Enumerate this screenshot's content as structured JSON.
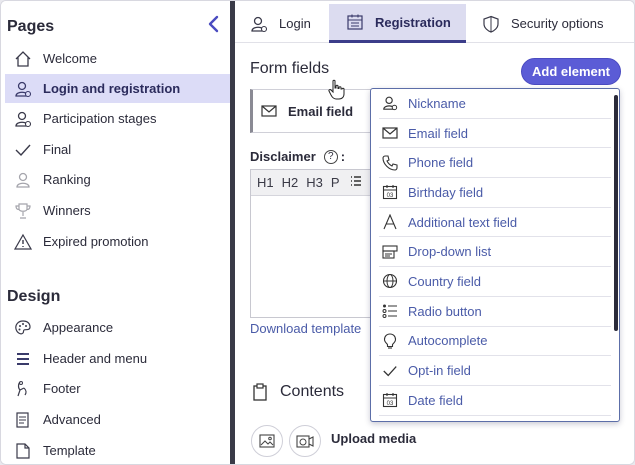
{
  "sidebar": {
    "pages_title": "Pages",
    "design_title": "Design",
    "pages": [
      {
        "label": "Welcome",
        "icon": "home-icon"
      },
      {
        "label": "Login and registration",
        "icon": "user-icon",
        "active": true
      },
      {
        "label": "Participation stages",
        "icon": "user-icon"
      },
      {
        "label": "Final",
        "icon": "check-icon"
      },
      {
        "label": "Ranking",
        "icon": "ranking-icon"
      },
      {
        "label": "Winners",
        "icon": "trophy-icon"
      },
      {
        "label": "Expired promotion",
        "icon": "warning-icon"
      }
    ],
    "design": [
      {
        "label": "Appearance",
        "icon": "palette-icon"
      },
      {
        "label": "Header and menu",
        "icon": "menu-icon"
      },
      {
        "label": "Footer",
        "icon": "footer-icon"
      },
      {
        "label": "Advanced",
        "icon": "advanced-icon"
      },
      {
        "label": "Template",
        "icon": "template-icon"
      }
    ]
  },
  "tabs": [
    {
      "label": "Login",
      "icon": "user-icon"
    },
    {
      "label": "Registration",
      "icon": "calendar-icon",
      "active": true
    },
    {
      "label": "Security options",
      "icon": "shield-icon"
    }
  ],
  "main": {
    "form_title": "Form fields",
    "add_button": "Add element",
    "email_card": "Email field",
    "disclaimer_label": "Disclaimer",
    "disclaimer_help": "?",
    "toolbar": [
      "H1",
      "H2",
      "H3",
      "P"
    ],
    "download_link": "Download template",
    "contents_title": "Contents",
    "upload_label": "Upload media"
  },
  "dropdown": {
    "items": [
      {
        "label": "Nickname",
        "icon": "user-icon"
      },
      {
        "label": "Email field",
        "icon": "envelope-icon"
      },
      {
        "label": "Phone field",
        "icon": "phone-icon"
      },
      {
        "label": "Birthday field",
        "icon": "calendar-day-icon"
      },
      {
        "label": "Additional text field",
        "icon": "text-icon"
      },
      {
        "label": "Drop-down list",
        "icon": "dropdown-list-icon"
      },
      {
        "label": "Country field",
        "icon": "globe-icon"
      },
      {
        "label": "Radio button",
        "icon": "radio-list-icon"
      },
      {
        "label": "Autocomplete",
        "icon": "bulb-icon"
      },
      {
        "label": "Opt-in field",
        "icon": "check-icon"
      },
      {
        "label": "Date field",
        "icon": "calendar-day-icon"
      }
    ]
  },
  "colors": {
    "accent": "#5b5cd6",
    "active_bg": "#dcdcf7",
    "link": "#4a5ba8",
    "divider": "#3a3b48"
  }
}
